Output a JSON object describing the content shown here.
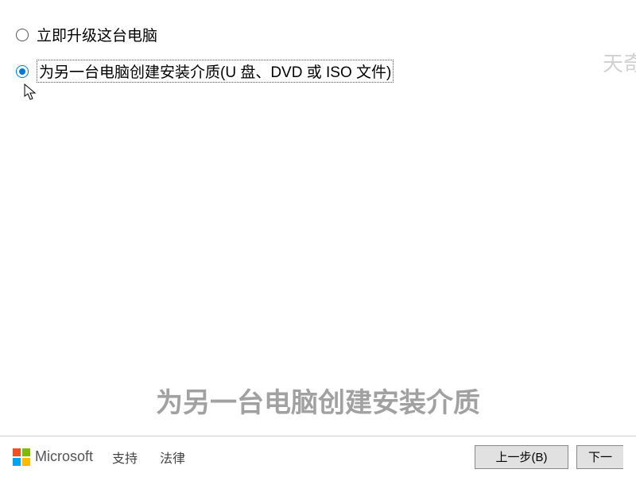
{
  "options": {
    "upgrade": "立即升级这台电脑",
    "create_media": "为另一台电脑创建安装介质(U 盘、DVD 或 ISO 文件)"
  },
  "footer": {
    "brand": "Microsoft",
    "support": "支持",
    "legal": "法律",
    "back": "上一步(B)",
    "next": "下一"
  },
  "overlay": {
    "subtitle": "为另一台电脑创建安装介质",
    "watermark": "天奇"
  }
}
